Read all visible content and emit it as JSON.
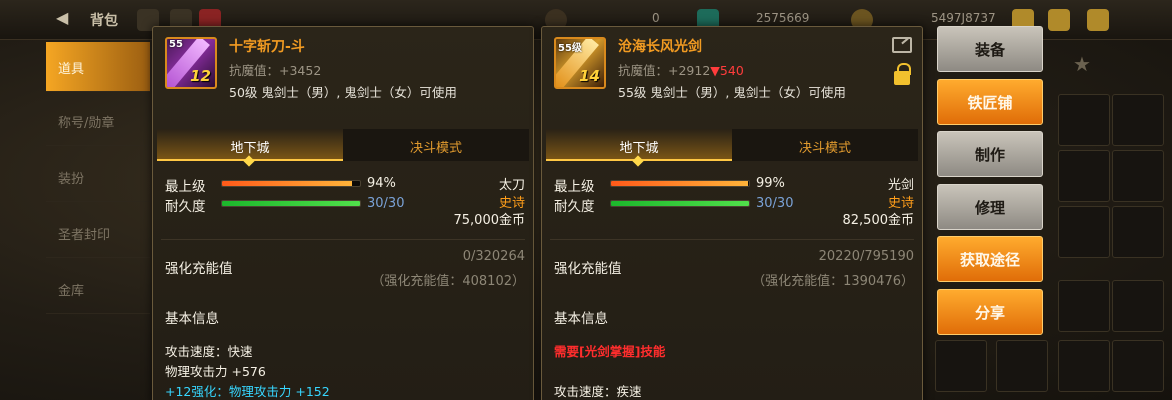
{
  "background": {
    "back_arrow": "◀",
    "title": "背包",
    "currency1": "0",
    "currency2": "2575669",
    "currency3": "5497J8737",
    "nav": [
      "道具",
      "称号/勋章",
      "装扮",
      "圣者封印",
      "金库"
    ],
    "nav_active_index": 0
  },
  "left_item": {
    "level_badge": "55",
    "enhance_badge": "12",
    "name": "十字斩刀-斗",
    "resist": "抗魔值：+3452",
    "requirement": "50级 鬼剑士（男）, 鬼剑士（女）可使用",
    "tabs": [
      "地下城",
      "决斗模式"
    ],
    "level_label": "最上级",
    "level_pct": 94,
    "level_text": "94%",
    "durability_label": "耐久度",
    "durability_cur": 30,
    "durability_max": 30,
    "durability_text": "30/30",
    "weapon_type": "太刀",
    "grade": "史诗",
    "price": "75,000金币",
    "reinforce_label": "强化充能值",
    "reinforce_value": "0/320264",
    "reinforce_total": "（强化充能值：408102）",
    "basic_title": "基本信息",
    "attr_speed": "攻击速度：快速",
    "attr_phys": "物理攻击力 +576",
    "attr_enhance": "+12强化：物理攻击力 +152"
  },
  "right_item": {
    "level_badge": "55级",
    "enhance_badge": "14",
    "name": "沧海长风光剑",
    "resist_prefix": "抗魔值：+2912",
    "resist_diff": "▼540",
    "requirement": "55级 鬼剑士（男）, 鬼剑士（女）可使用",
    "tabs": [
      "地下城",
      "决斗模式"
    ],
    "level_label": "最上级",
    "level_pct": 99,
    "level_text": "99%",
    "durability_label": "耐久度",
    "durability_cur": 30,
    "durability_max": 30,
    "durability_text": "30/30",
    "weapon_type": "光剑",
    "grade": "史诗",
    "price": "82,500金币",
    "reinforce_label": "强化充能值",
    "reinforce_value": "20220/795190",
    "reinforce_total": "（强化充能值：1390476）",
    "basic_title": "基本信息",
    "requirement_skill": "需要[光剑掌握]技能",
    "attr_speed": "攻击速度：疾速"
  },
  "actions": [
    "装备",
    "铁匠铺",
    "制作",
    "修理",
    "获取途径",
    "分享"
  ],
  "colors": {
    "orange_accent": "#f29b22",
    "button_orange": "#ef8a16",
    "button_gray": "#b6b1a8",
    "down_red": "#ff3c3c",
    "enhance_cyan": "#37d6ff"
  }
}
